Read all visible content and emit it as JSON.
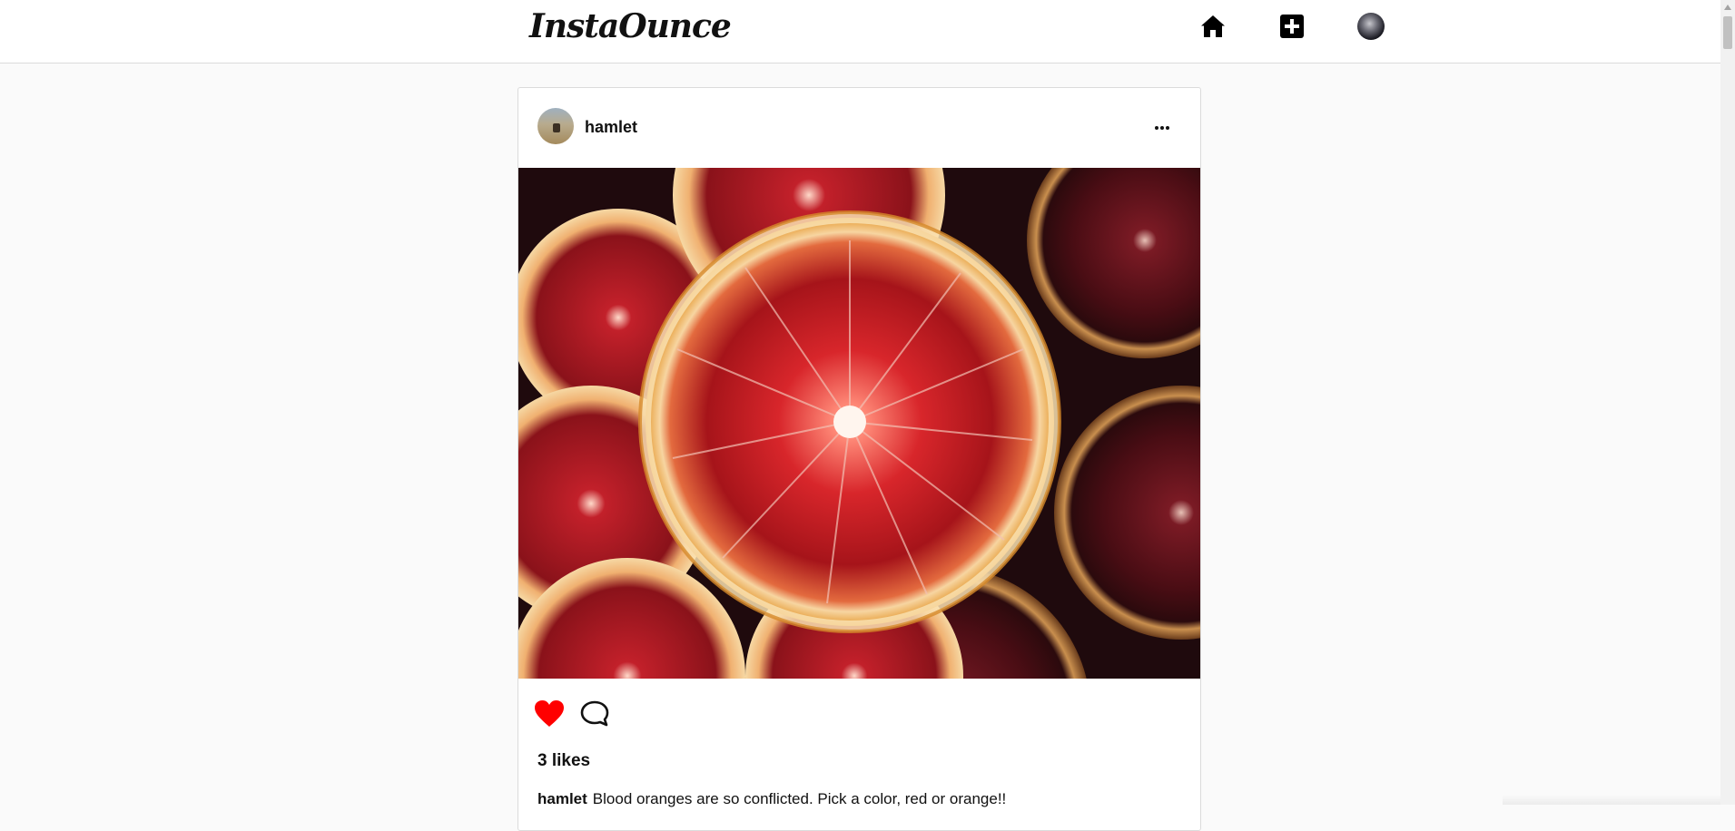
{
  "app": {
    "logo": "InstaOunce"
  },
  "nav": {
    "home_icon": "home-icon",
    "add_icon": "add-post-icon",
    "avatar_icon": "user-avatar"
  },
  "post": {
    "username": "hamlet",
    "more_icon": "more-options-icon",
    "image_subject": "blood-orange-slices",
    "liked": true,
    "like_color": "#ff0000",
    "likes_text": "3 likes",
    "caption_user": "hamlet",
    "caption_text": "Blood oranges are so conflicted. Pick a color, red or orange!!"
  },
  "colors": {
    "background": "#fafafa",
    "border": "#dbdbdb",
    "like_red": "#ff0000"
  }
}
